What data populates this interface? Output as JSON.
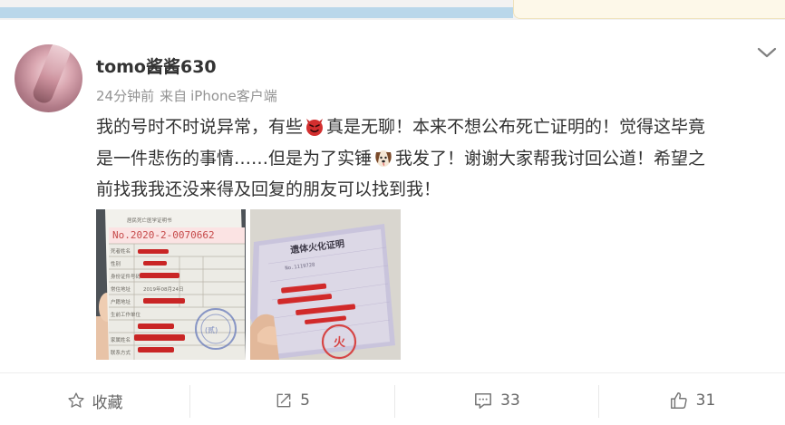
{
  "post": {
    "author": "tomo酱酱630",
    "time": "24分钟前",
    "source_prefix": "来自",
    "source": "iPhone客户端",
    "text_line1_a": "我的号时不时说异常，有些",
    "text_line1_b": "真是无聊！本来不想公布死亡证明的！觉得这毕竟",
    "text_line2_a": "是一件悲伤的事情……但是为了实锤",
    "text_line2_b": "我发了！谢谢大家帮我讨回公道！希望之",
    "text_line3": "前找我我还没来得及回复的朋友可以找到我！",
    "emoji1": "devil-emoji",
    "emoji2": "dog-emoji"
  },
  "photo1": {
    "header": "居民死亡医学证明书",
    "number": "No.2020-2-0070662",
    "rows": [
      "死者姓名",
      "性别",
      "身份证件号码",
      "常住地址",
      "户籍地址",
      "生前工作单位",
      "家属姓名",
      "联系方式"
    ],
    "mid_text": "2019年08月24日",
    "stamp_text": "(贰)"
  },
  "photo2": {
    "title": "遗体火化证明",
    "number": "No.1119728",
    "stamp_label": "火"
  },
  "actions": {
    "favorite_label": "收藏",
    "repost_count": "5",
    "comment_count": "33",
    "like_count": "31"
  }
}
